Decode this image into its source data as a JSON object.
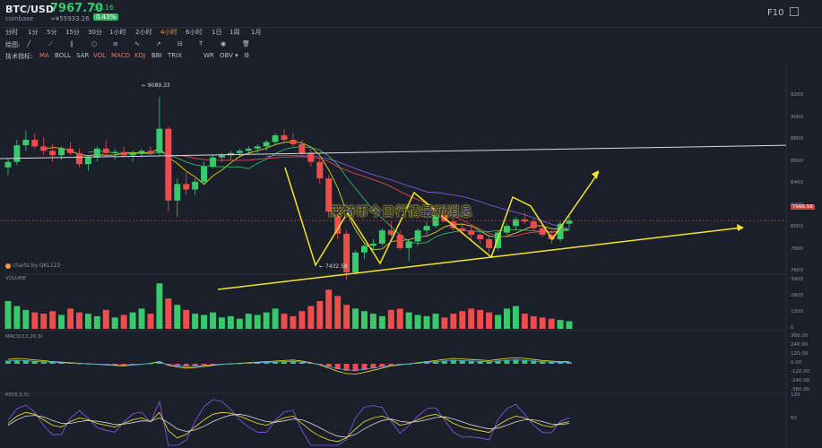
{
  "header": {
    "symbol": "BTC/USD",
    "exchange": "coinbase",
    "price": "7967.70",
    "cny": "≈¥55933.26",
    "change": "34.16",
    "change_pct": "0.43%",
    "f10": "F10",
    "fullscreen_icon": "fullscreen-icon"
  },
  "timeframes": [
    {
      "label": "分时",
      "active": false
    },
    {
      "label": "1分",
      "active": false
    },
    {
      "label": "5分",
      "active": false
    },
    {
      "label": "15分",
      "active": false
    },
    {
      "label": "30分",
      "active": false
    },
    {
      "label": "1小时",
      "active": false
    },
    {
      "label": "2小时",
      "active": false
    },
    {
      "label": "4小时",
      "active": true
    },
    {
      "label": "6小时",
      "active": false
    },
    {
      "label": "1日",
      "active": false
    },
    {
      "label": "1周",
      "active": false
    },
    {
      "label": "1月",
      "active": false
    }
  ],
  "draw_toolbar": {
    "label": "绘图:",
    "tools": [
      "line-tool-icon",
      "ray-tool-icon",
      "parallel-tool-icon",
      "circle-tool-icon",
      "fib-tool-icon",
      "wave-tool-icon",
      "arrow-tool-icon",
      "channel-tool-icon",
      "text-tool-icon",
      "eye-icon",
      "trash-icon"
    ]
  },
  "indicator_bar": {
    "label": "技术指标:",
    "items": [
      {
        "label": "MA",
        "active": true
      },
      {
        "label": "BOLL",
        "active": false
      },
      {
        "label": "SAR",
        "active": false
      },
      {
        "label": "VOL",
        "active": true
      },
      {
        "label": "MACD",
        "active": true
      },
      {
        "label": "KDJ",
        "active": true
      },
      {
        "label": "BBI",
        "active": false
      },
      {
        "label": "TRIX",
        "active": false
      },
      {
        "label": "WR",
        "active": false
      },
      {
        "label": "OBV ▾",
        "active": false
      }
    ],
    "settings_icon": "gear-icon"
  },
  "overlay_title": "莱特币今日行情最新消息",
  "brand_label": "charts by QKL123",
  "price_axis": [
    "9200",
    "9000",
    "8800",
    "8600",
    "8400",
    "8200",
    "8000",
    "7800",
    "7600"
  ],
  "current_price_tag": "7966.58",
  "high_label": "← 9089.33",
  "low_label": "← 7432.58",
  "volume_panel": {
    "title": "VOLUME",
    "axis": [
      "3900",
      "2600",
      "1300",
      "0"
    ]
  },
  "macd_panel": {
    "title": "MACD(12,26,9)",
    "axis": [
      "360.00",
      "240.00",
      "120.00",
      "0.00",
      "-120.00",
      "-240.00",
      "-360.00"
    ]
  },
  "kd_panel": {
    "title": "KD(9,3,3)",
    "axis": [
      "120",
      "60"
    ]
  },
  "colors": {
    "up": "#37c96b",
    "down": "#ef4d4d",
    "accent": "#f09a3b",
    "background": "#1b1f2a",
    "annotation": "#f5e428"
  },
  "chart_data": {
    "type": "candlestick",
    "candles": [
      [
        8450,
        8530,
        8380,
        8500
      ],
      [
        8500,
        8700,
        8470,
        8650
      ],
      [
        8650,
        8780,
        8600,
        8700
      ],
      [
        8700,
        8760,
        8620,
        8640
      ],
      [
        8640,
        8720,
        8560,
        8600
      ],
      [
        8600,
        8660,
        8500,
        8560
      ],
      [
        8560,
        8640,
        8520,
        8620
      ],
      [
        8620,
        8680,
        8560,
        8580
      ],
      [
        8580,
        8620,
        8450,
        8480
      ],
      [
        8480,
        8560,
        8420,
        8540
      ],
      [
        8540,
        8640,
        8500,
        8620
      ],
      [
        8620,
        8700,
        8560,
        8580
      ],
      [
        8580,
        8620,
        8520,
        8590
      ],
      [
        8590,
        8640,
        8540,
        8560
      ],
      [
        8560,
        8600,
        8500,
        8580
      ],
      [
        8580,
        8620,
        8540,
        8600
      ],
      [
        8600,
        8640,
        8560,
        8580
      ],
      [
        8580,
        9089,
        8560,
        8800
      ],
      [
        8800,
        8820,
        8050,
        8150
      ],
      [
        8150,
        8350,
        8000,
        8300
      ],
      [
        8300,
        8400,
        8200,
        8250
      ],
      [
        8250,
        8350,
        8200,
        8320
      ],
      [
        8320,
        8500,
        8300,
        8460
      ],
      [
        8460,
        8560,
        8440,
        8540
      ],
      [
        8540,
        8580,
        8500,
        8560
      ],
      [
        8560,
        8600,
        8520,
        8580
      ],
      [
        8580,
        8620,
        8540,
        8600
      ],
      [
        8600,
        8640,
        8560,
        8620
      ],
      [
        8620,
        8660,
        8580,
        8640
      ],
      [
        8640,
        8700,
        8600,
        8680
      ],
      [
        8680,
        8760,
        8650,
        8740
      ],
      [
        8740,
        8800,
        8680,
        8700
      ],
      [
        8700,
        8760,
        8640,
        8660
      ],
      [
        8660,
        8700,
        8560,
        8580
      ],
      [
        8580,
        8620,
        8460,
        8500
      ],
      [
        8500,
        8540,
        8300,
        8350
      ],
      [
        8350,
        8380,
        8000,
        8050
      ],
      [
        8050,
        8100,
        7800,
        7850
      ],
      [
        7850,
        7880,
        7432,
        7500
      ],
      [
        7500,
        7700,
        7480,
        7680
      ],
      [
        7680,
        7760,
        7620,
        7740
      ],
      [
        7740,
        7800,
        7700,
        7760
      ],
      [
        7760,
        7900,
        7740,
        7880
      ],
      [
        7880,
        7960,
        7820,
        7840
      ],
      [
        7840,
        7880,
        7700,
        7720
      ],
      [
        7720,
        7800,
        7600,
        7780
      ],
      [
        7780,
        7900,
        7740,
        7880
      ],
      [
        7880,
        7960,
        7840,
        7920
      ],
      [
        7920,
        8050,
        7900,
        8020
      ],
      [
        8020,
        8100,
        7980,
        7960
      ],
      [
        7960,
        8000,
        7880,
        7900
      ],
      [
        7900,
        7950,
        7850,
        7880
      ],
      [
        7880,
        7920,
        7800,
        7840
      ],
      [
        7840,
        7880,
        7760,
        7800
      ],
      [
        7800,
        7840,
        7680,
        7720
      ],
      [
        7720,
        7880,
        7700,
        7860
      ],
      [
        7860,
        7940,
        7840,
        7920
      ],
      [
        7920,
        8000,
        7880,
        7980
      ],
      [
        7980,
        8040,
        7940,
        7960
      ],
      [
        7960,
        8000,
        7880,
        7900
      ],
      [
        7900,
        7940,
        7820,
        7840
      ],
      [
        7840,
        7880,
        7760,
        7800
      ],
      [
        7800,
        7960,
        7780,
        7940
      ],
      [
        7940,
        8010,
        7900,
        7968
      ]
    ],
    "y_range": [
      7500,
      9300
    ],
    "volumes": [
      2200,
      1800,
      1500,
      1300,
      1200,
      1400,
      1100,
      1600,
      1300,
      1200,
      1000,
      1500,
      900,
      1100,
      1300,
      1600,
      1200,
      3600,
      2400,
      1900,
      1500,
      1200,
      1100,
      1300,
      900,
      1000,
      800,
      1200,
      1100,
      1300,
      1600,
      1200,
      1000,
      1400,
      1800,
      2200,
      3100,
      2600,
      1900,
      1600,
      1400,
      1200,
      1000,
      1500,
      1600,
      1300,
      1100,
      1000,
      1200,
      900,
      1200,
      1400,
      1600,
      1500,
      1300,
      1100,
      1600,
      1800,
      1200,
      1000,
      900,
      800,
      700,
      600
    ],
    "volume_range": [
      0,
      3900
    ],
    "macd_hist": [
      40,
      50,
      45,
      35,
      30,
      20,
      15,
      10,
      5,
      0,
      -5,
      -10,
      -15,
      -20,
      -10,
      -5,
      5,
      20,
      -15,
      -30,
      -40,
      -35,
      -25,
      -15,
      -5,
      0,
      5,
      10,
      15,
      20,
      25,
      30,
      35,
      25,
      10,
      -10,
      -40,
      -70,
      -90,
      -95,
      -80,
      -60,
      -40,
      -20,
      -10,
      0,
      10,
      20,
      30,
      40,
      50,
      45,
      40,
      35,
      30,
      40,
      50,
      55,
      50,
      40,
      30,
      25,
      20,
      20
    ],
    "macd_range": [
      -360,
      360
    ],
    "kd_k": [
      60,
      80,
      90,
      85,
      70,
      55,
      50,
      65,
      75,
      70,
      60,
      55,
      50,
      60,
      70,
      75,
      65,
      90,
      40,
      20,
      30,
      50,
      70,
      85,
      90,
      88,
      80,
      70,
      60,
      55,
      65,
      75,
      80,
      60,
      40,
      25,
      15,
      10,
      20,
      45,
      65,
      75,
      80,
      70,
      55,
      60,
      70,
      80,
      85,
      75,
      60,
      50,
      45,
      40,
      35,
      55,
      70,
      80,
      75,
      65,
      55,
      50,
      60,
      65
    ],
    "kd_d": [
      55,
      70,
      80,
      82,
      78,
      68,
      60,
      60,
      65,
      68,
      66,
      62,
      57,
      58,
      62,
      67,
      66,
      75,
      62,
      45,
      38,
      42,
      52,
      65,
      75,
      83,
      85,
      80,
      72,
      65,
      63,
      67,
      72,
      70,
      60,
      48,
      35,
      25,
      22,
      30,
      45,
      58,
      68,
      72,
      66,
      63,
      65,
      70,
      76,
      78,
      72,
      64,
      56,
      50,
      45,
      47,
      55,
      64,
      70,
      70,
      65,
      58,
      57,
      60
    ],
    "kd_range": [
      0,
      130
    ]
  }
}
